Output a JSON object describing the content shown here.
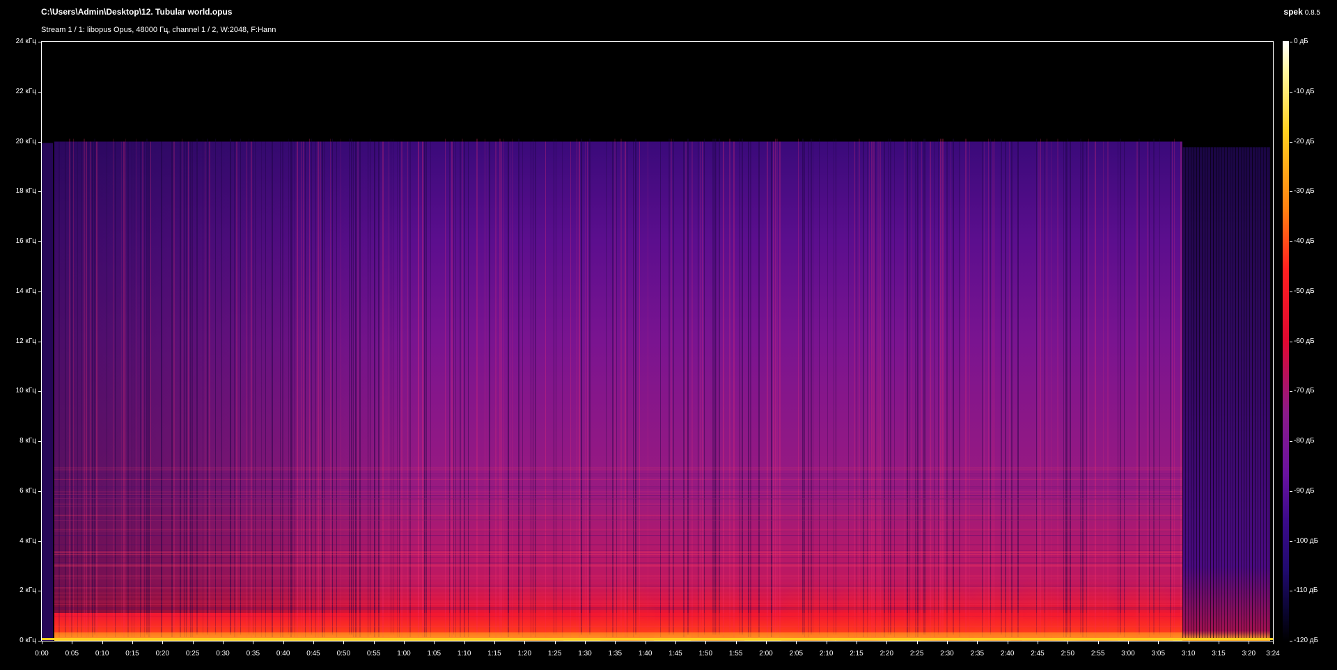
{
  "header": {
    "file_path": "C:\\Users\\Admin\\Desktop\\12. Tubular world.opus",
    "stream_info": "Stream 1 / 1: libopus Opus, 48000 Гц, channel 1 / 2, W:2048, F:Hann",
    "app_name": "spek",
    "app_version": "0.8.5"
  },
  "chart_data": {
    "type": "heatmap",
    "title": "",
    "xlabel": "",
    "ylabel": "",
    "x_range_seconds": [
      0,
      204
    ],
    "y_range_khz": [
      0,
      24
    ],
    "color_range_db": [
      -120,
      0
    ],
    "y_ticks": [
      "0 кГц",
      "2 кГц",
      "4 кГц",
      "6 кГц",
      "8 кГц",
      "10 кГц",
      "12 кГц",
      "14 кГц",
      "16 кГц",
      "18 кГц",
      "20 кГц",
      "22 кГц",
      "24 кГц"
    ],
    "x_ticks": [
      "0:00",
      "0:05",
      "0:10",
      "0:15",
      "0:20",
      "0:25",
      "0:30",
      "0:35",
      "0:40",
      "0:45",
      "0:50",
      "0:55",
      "1:00",
      "1:05",
      "1:10",
      "1:15",
      "1:20",
      "1:25",
      "1:30",
      "1:35",
      "1:40",
      "1:45",
      "1:50",
      "1:55",
      "2:00",
      "2:05",
      "2:10",
      "2:15",
      "2:20",
      "2:25",
      "2:30",
      "2:35",
      "2:40",
      "2:45",
      "2:50",
      "2:55",
      "3:00",
      "3:05",
      "3:10",
      "3:15",
      "3:20",
      "3:24"
    ],
    "db_ticks": [
      "0 дБ",
      "-10 дБ",
      "-20 дБ",
      "-30 дБ",
      "-40 дБ",
      "-50 дБ",
      "-60 дБ",
      "-70 дБ",
      "-80 дБ",
      "-90 дБ",
      "-100 дБ",
      "-110 дБ",
      "-120 дБ"
    ],
    "upper_cutoff_khz": 20,
    "content_end_seconds": 189,
    "colors": {
      "background": "#000000",
      "low": "#1a0533",
      "mid_low": "#3a0a8a",
      "mid": "#8a1a8a",
      "mid_high": "#d01050",
      "high": "#ff2020",
      "peak": "#ffd020",
      "max": "#ffffff"
    }
  }
}
